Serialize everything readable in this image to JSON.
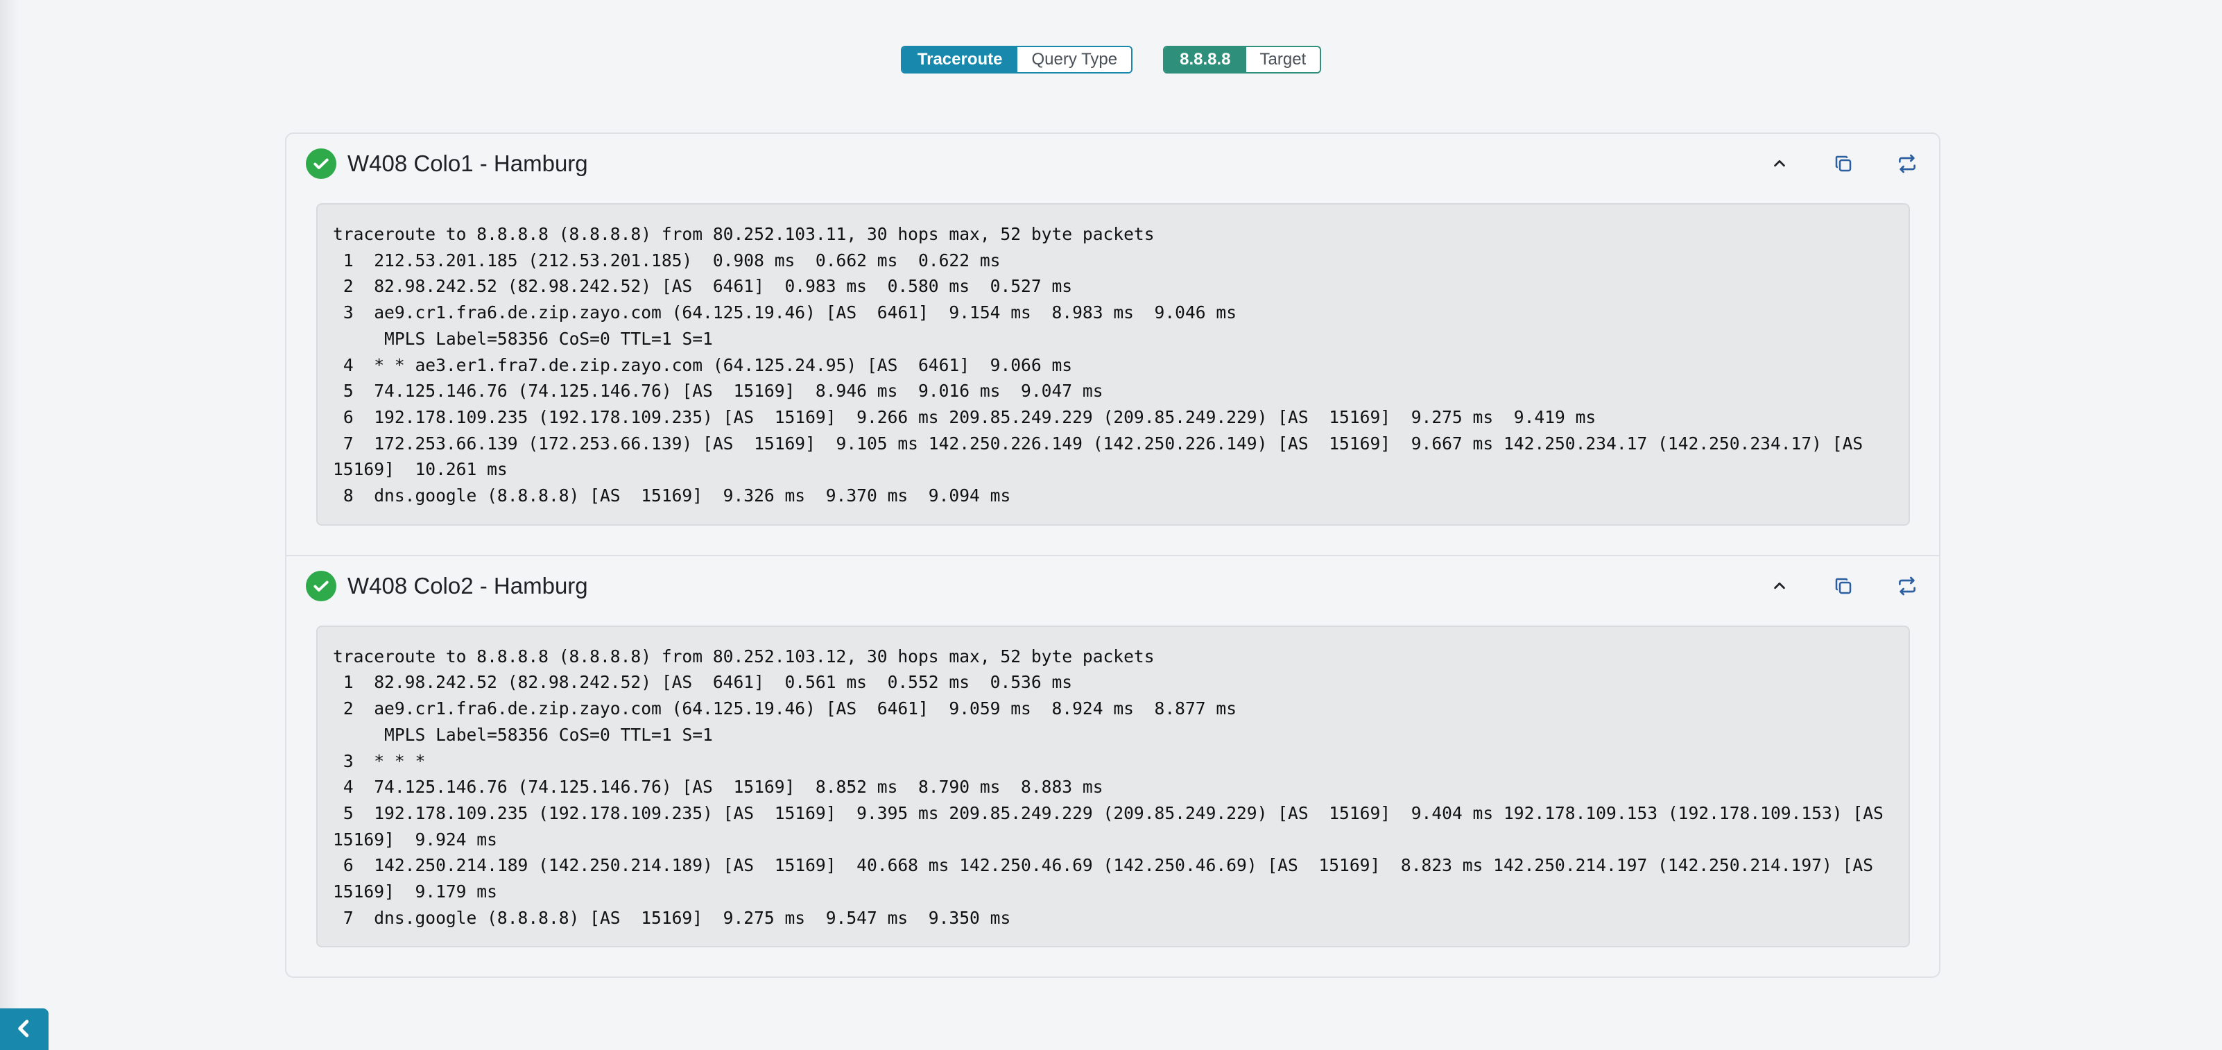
{
  "query_type": {
    "value": "Traceroute",
    "label": "Query Type"
  },
  "target": {
    "value": "8.8.8.8",
    "label": "Target"
  },
  "results": [
    {
      "title": "W408 Colo1 - Hamburg",
      "status": "success",
      "output": "traceroute to 8.8.8.8 (8.8.8.8) from 80.252.103.11, 30 hops max, 52 byte packets\n 1  212.53.201.185 (212.53.201.185)  0.908 ms  0.662 ms  0.622 ms\n 2  82.98.242.52 (82.98.242.52) [AS  6461]  0.983 ms  0.580 ms  0.527 ms\n 3  ae9.cr1.fra6.de.zip.zayo.com (64.125.19.46) [AS  6461]  9.154 ms  8.983 ms  9.046 ms\n     MPLS Label=58356 CoS=0 TTL=1 S=1\n 4  * * ae3.er1.fra7.de.zip.zayo.com (64.125.24.95) [AS  6461]  9.066 ms\n 5  74.125.146.76 (74.125.146.76) [AS  15169]  8.946 ms  9.016 ms  9.047 ms\n 6  192.178.109.235 (192.178.109.235) [AS  15169]  9.266 ms 209.85.249.229 (209.85.249.229) [AS  15169]  9.275 ms  9.419 ms\n 7  172.253.66.139 (172.253.66.139) [AS  15169]  9.105 ms 142.250.226.149 (142.250.226.149) [AS  15169]  9.667 ms 142.250.234.17 (142.250.234.17) [AS  15169]  10.261 ms\n 8  dns.google (8.8.8.8) [AS  15169]  9.326 ms  9.370 ms  9.094 ms"
    },
    {
      "title": "W408 Colo2 - Hamburg",
      "status": "success",
      "output": "traceroute to 8.8.8.8 (8.8.8.8) from 80.252.103.12, 30 hops max, 52 byte packets\n 1  82.98.242.52 (82.98.242.52) [AS  6461]  0.561 ms  0.552 ms  0.536 ms\n 2  ae9.cr1.fra6.de.zip.zayo.com (64.125.19.46) [AS  6461]  9.059 ms  8.924 ms  8.877 ms\n     MPLS Label=58356 CoS=0 TTL=1 S=1\n 3  * * *\n 4  74.125.146.76 (74.125.146.76) [AS  15169]  8.852 ms  8.790 ms  8.883 ms\n 5  192.178.109.235 (192.178.109.235) [AS  15169]  9.395 ms 209.85.249.229 (209.85.249.229) [AS  15169]  9.404 ms 192.178.109.153 (192.178.109.153) [AS  15169]  9.924 ms\n 6  142.250.214.189 (142.250.214.189) [AS  15169]  40.668 ms 142.250.46.69 (142.250.46.69) [AS  15169]  8.823 ms 142.250.214.197 (142.250.214.197) [AS  15169]  9.179 ms\n 7  dns.google (8.8.8.8) [AS  15169]  9.275 ms  9.547 ms  9.350 ms"
    }
  ],
  "icons": {
    "status": "check-circle-icon",
    "collapse": "chevron-up-icon",
    "copy": "copy-icon",
    "rerun": "refresh-icon",
    "back": "chevron-left-icon"
  },
  "colors": {
    "query_type_accent": "#1888ad",
    "target_accent": "#2e907a",
    "success": "#2faa4a",
    "action_icon": "#2c5fa0"
  }
}
